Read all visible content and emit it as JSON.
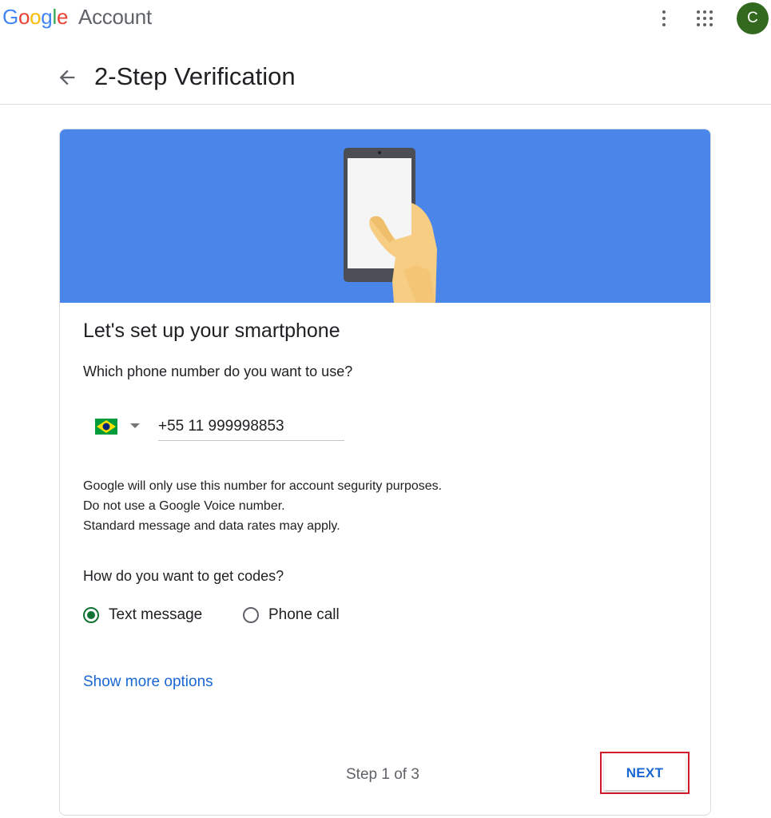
{
  "topbar": {
    "logo_word": "Google",
    "logo_suffix": "Account",
    "more_icon": "more-vert-icon",
    "apps_icon": "apps-grid-icon",
    "avatar_initial": "C",
    "avatar_color": "#33691e"
  },
  "header": {
    "back_icon": "arrow-back-icon",
    "title": "2-Step Verification"
  },
  "hero": {
    "background_color": "#4a86ea",
    "illustration": "hand-holding-smartphone"
  },
  "card": {
    "title": "Let's set up your smartphone",
    "phone_question": "Which phone number do you want to use?",
    "country_flag_icon": "brazil-flag-icon",
    "phone_value": "+55 11 999998853",
    "notes": [
      "Google will only use this number for account segurity purposes.",
      "Do not use a Google Voice number.",
      "Standard message and data rates may apply."
    ],
    "codes_question": "How do you want to get codes?",
    "options": [
      {
        "label": "Text message",
        "selected": true
      },
      {
        "label": "Phone call",
        "selected": false
      }
    ],
    "show_more": "Show more options",
    "step_text": "Step 1 of 3",
    "next_label": "NEXT"
  },
  "colors": {
    "accent_blue": "#1967d2",
    "radio_green": "#137333",
    "highlight_red": "#d11b2b"
  }
}
